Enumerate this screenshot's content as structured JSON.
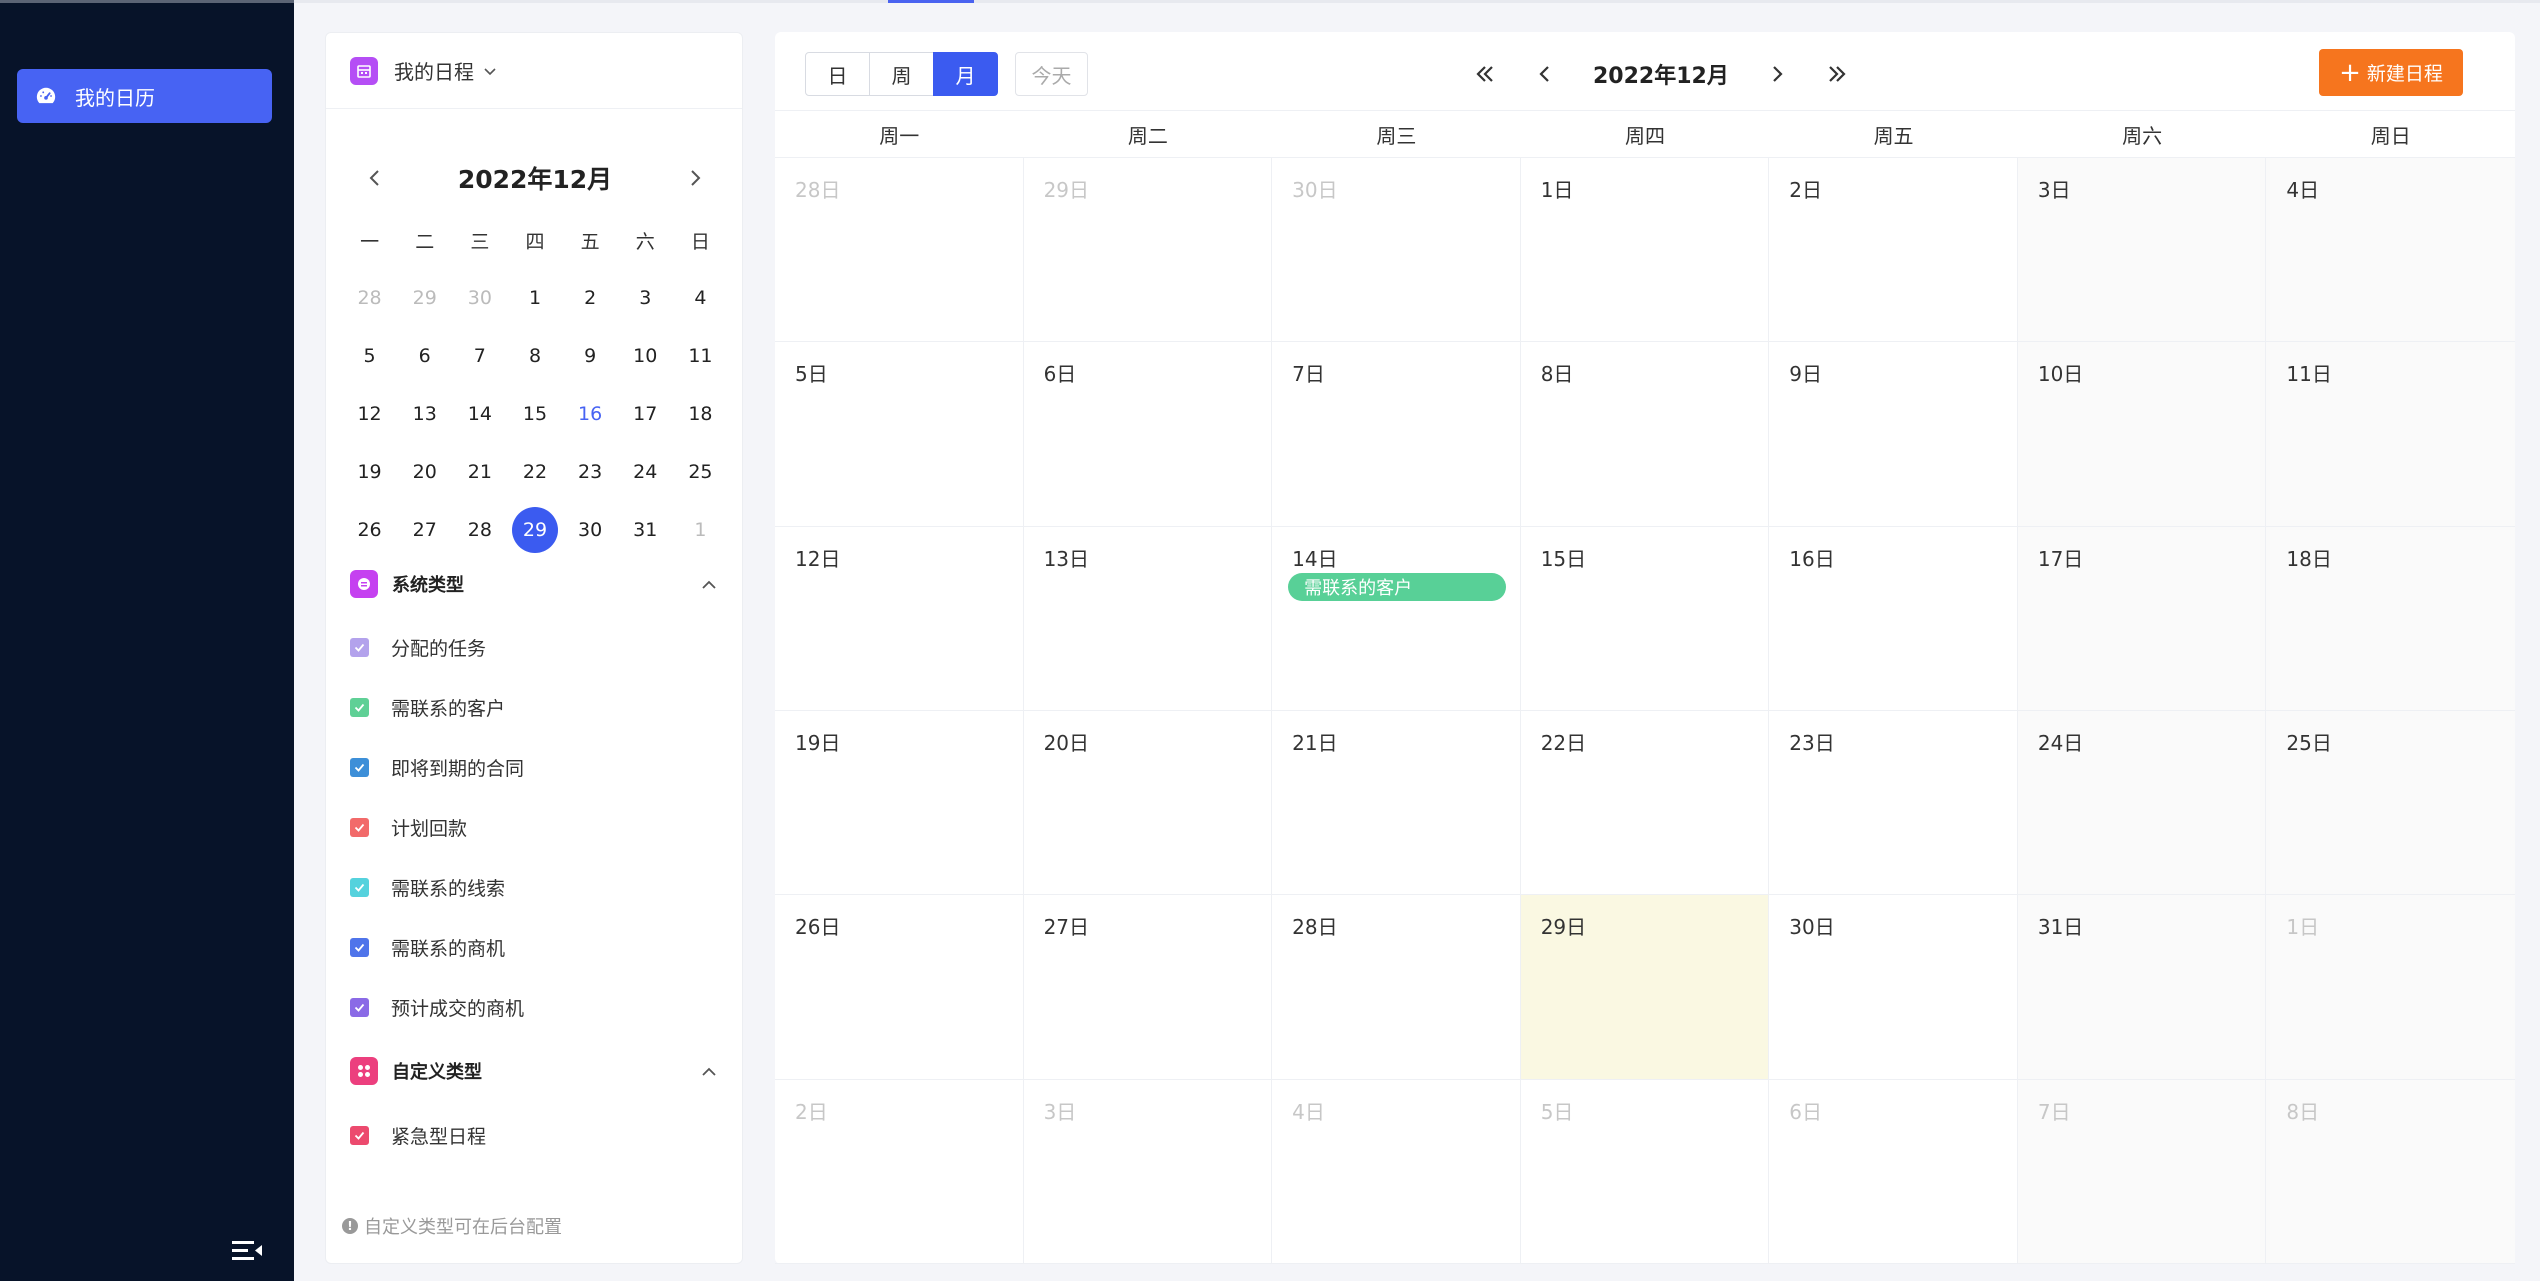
{
  "sidebar": {
    "nav_label": "我的日历"
  },
  "panel": {
    "title": "我的日程",
    "mini_title": "2022年12月",
    "weekdays": [
      "一",
      "二",
      "三",
      "四",
      "五",
      "六",
      "日"
    ],
    "days": [
      {
        "d": "28",
        "cls": "other"
      },
      {
        "d": "29",
        "cls": "other"
      },
      {
        "d": "30",
        "cls": "other"
      },
      {
        "d": "1"
      },
      {
        "d": "2"
      },
      {
        "d": "3"
      },
      {
        "d": "4"
      },
      {
        "d": "5"
      },
      {
        "d": "6"
      },
      {
        "d": "7"
      },
      {
        "d": "8"
      },
      {
        "d": "9"
      },
      {
        "d": "10"
      },
      {
        "d": "11"
      },
      {
        "d": "12"
      },
      {
        "d": "13"
      },
      {
        "d": "14"
      },
      {
        "d": "15"
      },
      {
        "d": "16",
        "cls": "today-link"
      },
      {
        "d": "17"
      },
      {
        "d": "18"
      },
      {
        "d": "19"
      },
      {
        "d": "20"
      },
      {
        "d": "21"
      },
      {
        "d": "22"
      },
      {
        "d": "23"
      },
      {
        "d": "24"
      },
      {
        "d": "25"
      },
      {
        "d": "26"
      },
      {
        "d": "27"
      },
      {
        "d": "28"
      },
      {
        "d": "29",
        "cls": "sel"
      },
      {
        "d": "30"
      },
      {
        "d": "31"
      },
      {
        "d": "1",
        "cls": "other"
      }
    ],
    "system_section": "系统类型",
    "system_types": [
      {
        "label": "分配的任务",
        "color": "#b3a2ec"
      },
      {
        "label": "需联系的客户",
        "color": "#5fd096"
      },
      {
        "label": "即将到期的合同",
        "color": "#3d8fd8"
      },
      {
        "label": "计划回款",
        "color": "#f26a6a"
      },
      {
        "label": "需联系的线索",
        "color": "#55d2dd"
      },
      {
        "label": "需联系的商机",
        "color": "#4f74ea"
      },
      {
        "label": "预计成交的商机",
        "color": "#8a6ae6"
      }
    ],
    "custom_section": "自定义类型",
    "custom_types": [
      {
        "label": "紧急型日程",
        "color": "#ec4a6e"
      }
    ],
    "hint": "自定义类型可在后台配置"
  },
  "main": {
    "views": [
      "日",
      "周",
      "月"
    ],
    "active_view": "月",
    "today_label": "今天",
    "month_title": "2022年12月",
    "new_label": "新建日程",
    "week_headers": [
      "周一",
      "周二",
      "周三",
      "周四",
      "周五",
      "周六",
      "周日"
    ],
    "cells": [
      {
        "n": "28日",
        "other": true
      },
      {
        "n": "29日",
        "other": true
      },
      {
        "n": "30日",
        "other": true
      },
      {
        "n": "1日"
      },
      {
        "n": "2日"
      },
      {
        "n": "3日"
      },
      {
        "n": "4日"
      },
      {
        "n": "5日"
      },
      {
        "n": "6日"
      },
      {
        "n": "7日"
      },
      {
        "n": "8日"
      },
      {
        "n": "9日"
      },
      {
        "n": "10日"
      },
      {
        "n": "11日"
      },
      {
        "n": "12日"
      },
      {
        "n": "13日"
      },
      {
        "n": "14日",
        "event": "需联系的客户"
      },
      {
        "n": "15日"
      },
      {
        "n": "16日"
      },
      {
        "n": "17日"
      },
      {
        "n": "18日"
      },
      {
        "n": "19日"
      },
      {
        "n": "20日"
      },
      {
        "n": "21日"
      },
      {
        "n": "22日"
      },
      {
        "n": "23日"
      },
      {
        "n": "24日"
      },
      {
        "n": "25日"
      },
      {
        "n": "26日"
      },
      {
        "n": "27日"
      },
      {
        "n": "28日"
      },
      {
        "n": "29日",
        "today": true
      },
      {
        "n": "30日"
      },
      {
        "n": "31日"
      },
      {
        "n": "1日",
        "other": true
      },
      {
        "n": "2日",
        "other": true
      },
      {
        "n": "3日",
        "other": true
      },
      {
        "n": "4日",
        "other": true
      },
      {
        "n": "5日",
        "other": true
      },
      {
        "n": "6日",
        "other": true
      },
      {
        "n": "7日",
        "other": true
      },
      {
        "n": "8日",
        "other": true
      }
    ]
  },
  "colors": {
    "sidebar_bg": "#071329",
    "accent": "#3b5bf0",
    "new_button": "#f6751e",
    "event_green": "#58d097",
    "today_bg": "#faf8e2"
  }
}
